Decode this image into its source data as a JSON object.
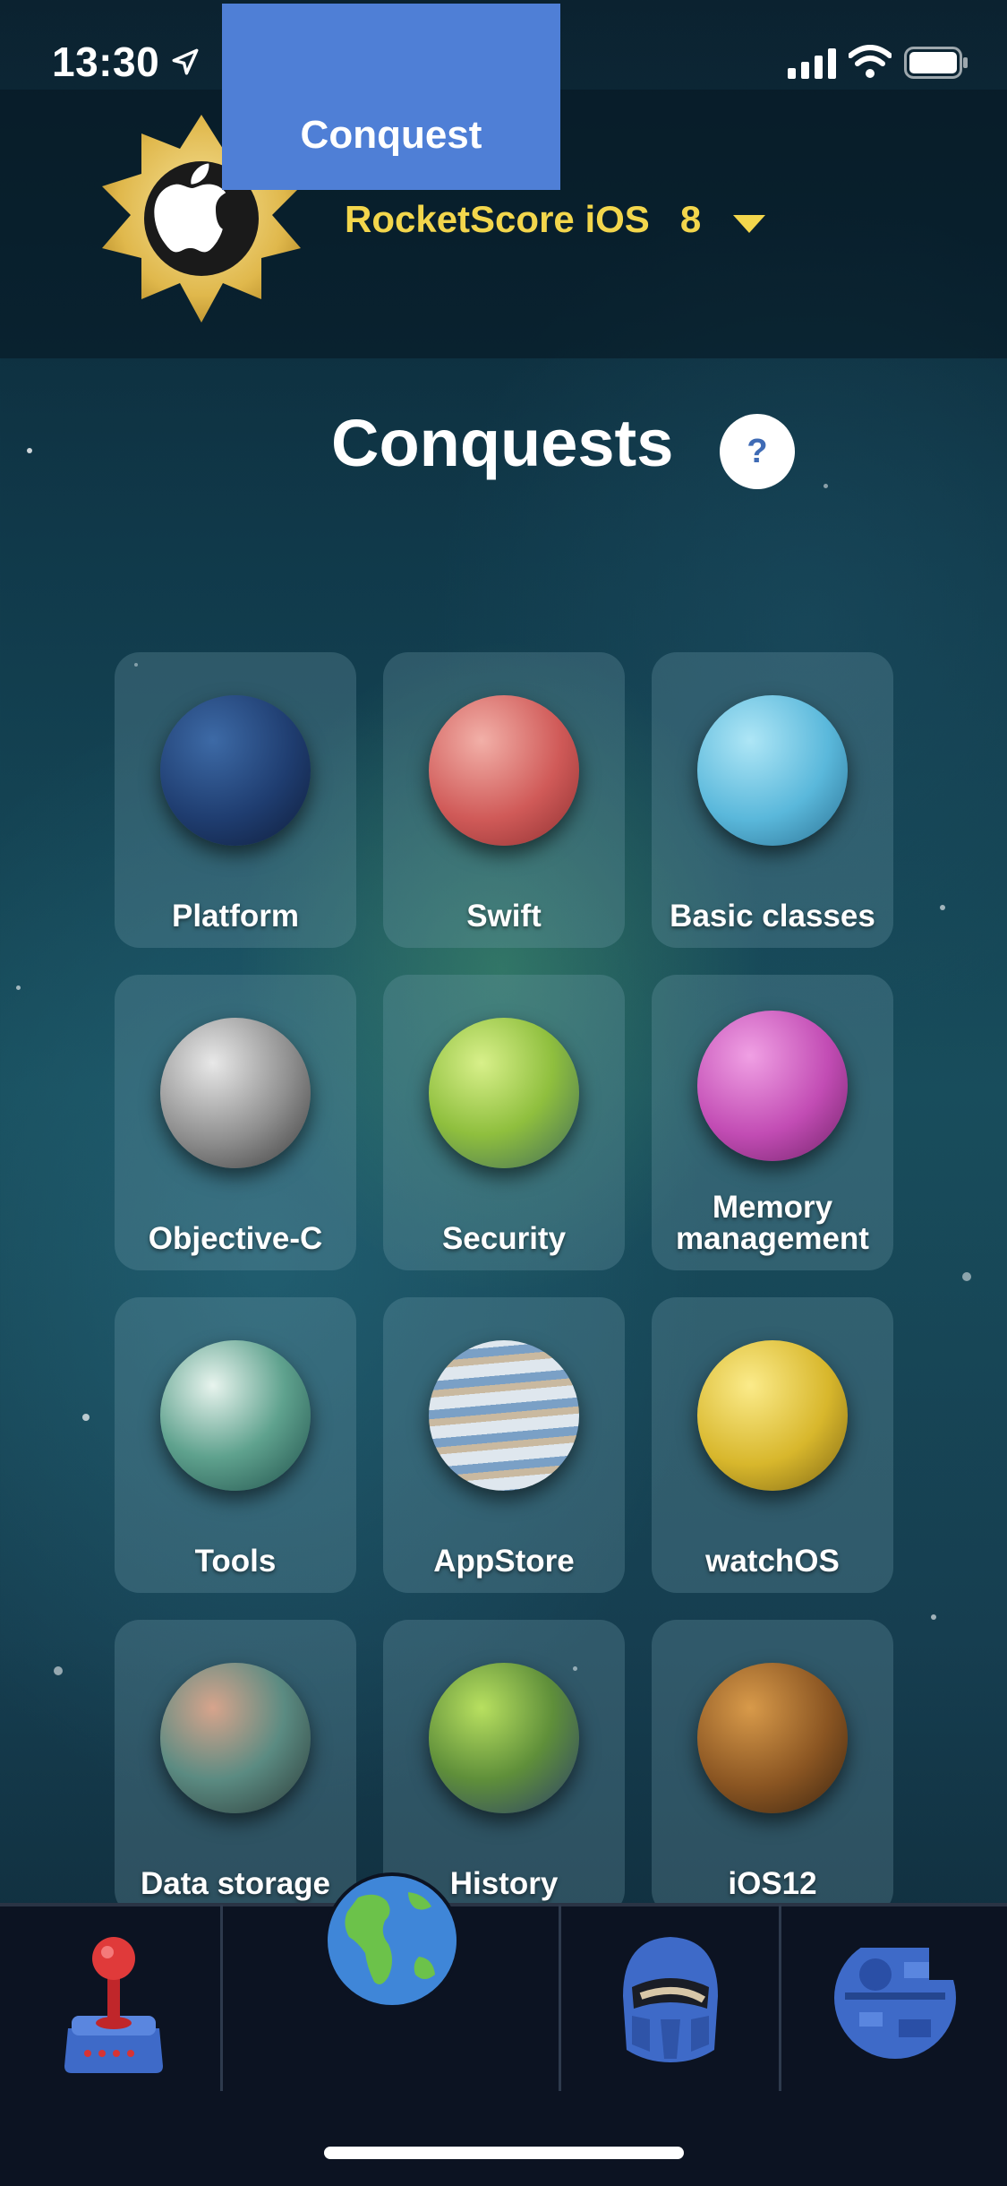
{
  "status_bar": {
    "time": "13:30"
  },
  "header": {
    "app_name": "RocketScore iOS",
    "level": "8"
  },
  "page": {
    "title": "Conquests",
    "help_label": "?"
  },
  "topics": [
    {
      "label": "Platform"
    },
    {
      "label": "Swift"
    },
    {
      "label": "Basic classes"
    },
    {
      "label": "Objective-C"
    },
    {
      "label": "Security"
    },
    {
      "label": "Memory management"
    },
    {
      "label": "Tools"
    },
    {
      "label": "AppStore"
    },
    {
      "label": "watchOS"
    },
    {
      "label": "Data storage"
    },
    {
      "label": "History"
    },
    {
      "label": "iOS12"
    }
  ],
  "tab_bar": {
    "active_label": "Conquest"
  },
  "colors": {
    "accent": "#4f7fd6",
    "title_yellow": "#f3d64c"
  }
}
